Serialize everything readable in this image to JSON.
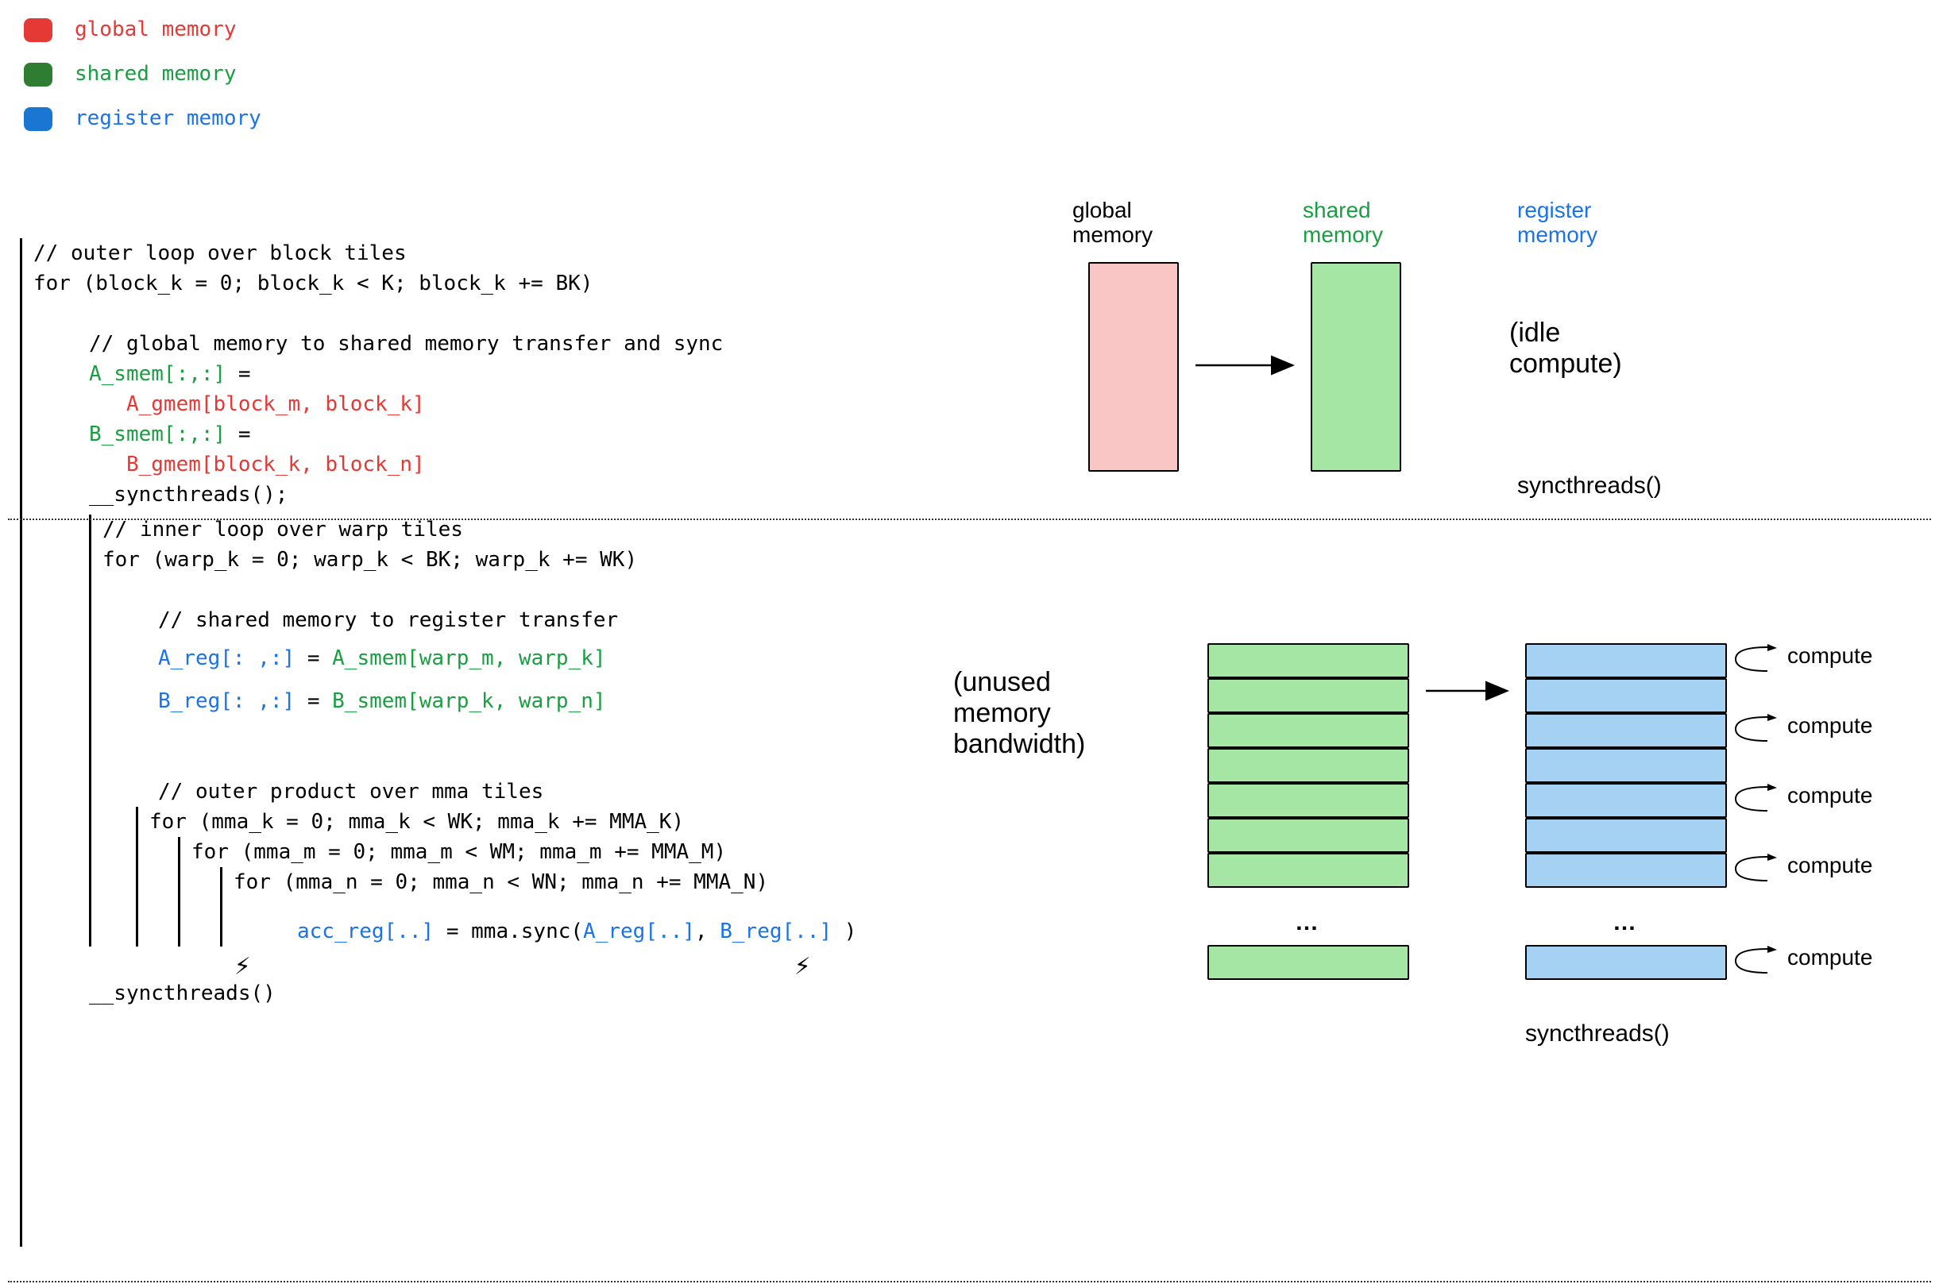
{
  "legend": {
    "global": "global memory",
    "shared": "shared memory",
    "register": "register memory"
  },
  "colors": {
    "red": "#E53935",
    "green": "#2E7D32",
    "blue": "#1976D2",
    "pink_fill": "#F9C5C5",
    "green_fill": "#A5E6A5",
    "blue_fill": "#A5D2F2"
  },
  "code": {
    "c1": "// outer loop over block tiles",
    "c2": "for (block_k = 0; block_k < K; block_k += BK)",
    "c3": "// global memory to shared memory transfer and sync",
    "c4a": "A_smem[:,:]",
    "c4b": " = ",
    "c5": "A_gmem[block_m, block_k]",
    "c6a": "B_smem[:,:]",
    "c6b": " = ",
    "c7": "B_gmem[block_k, block_n]",
    "c8": "__syncthreads();",
    "c9": "// inner loop over warp tiles",
    "c10": "for (warp_k = 0; warp_k < BK; warp_k += WK)",
    "c11": "// shared memory to register transfer",
    "c12a": "A_reg[: ,:]",
    "c12b": " = ",
    "c12c": "A_smem[warp_m, warp_k]",
    "c13a": "B_reg[: ,:]",
    "c13b": " = ",
    "c13c": "B_smem[warp_k, warp_n]",
    "c14": "// outer product over mma tiles",
    "c15": "for (mma_k = 0; mma_k < WK; mma_k += MMA_K)",
    "c16": "for (mma_m = 0; mma_m < WM; mma_m += MMA_M)",
    "c17": "for (mma_n = 0; mma_n < WN; mma_n += MMA_N)",
    "c18a": "acc_reg[..]",
    "c18b": " = mma.sync(",
    "c18c": "A_reg[..]",
    "c18d": ", ",
    "c18e": "B_reg[..]",
    "c18f": " )",
    "c19": "__syncthreads()"
  },
  "diagram": {
    "top": {
      "global_label": "global memory",
      "shared_label": "shared memory",
      "register_label": "register memory",
      "idle_note": "(idle compute)",
      "sync_label": "syncthreads()"
    },
    "bottom": {
      "unused_note": "(unused memory bandwidth)",
      "compute_label": "compute",
      "ellipsis": "…",
      "sync_label": "syncthreads()"
    }
  },
  "icons": {
    "bolt": "⚡"
  }
}
